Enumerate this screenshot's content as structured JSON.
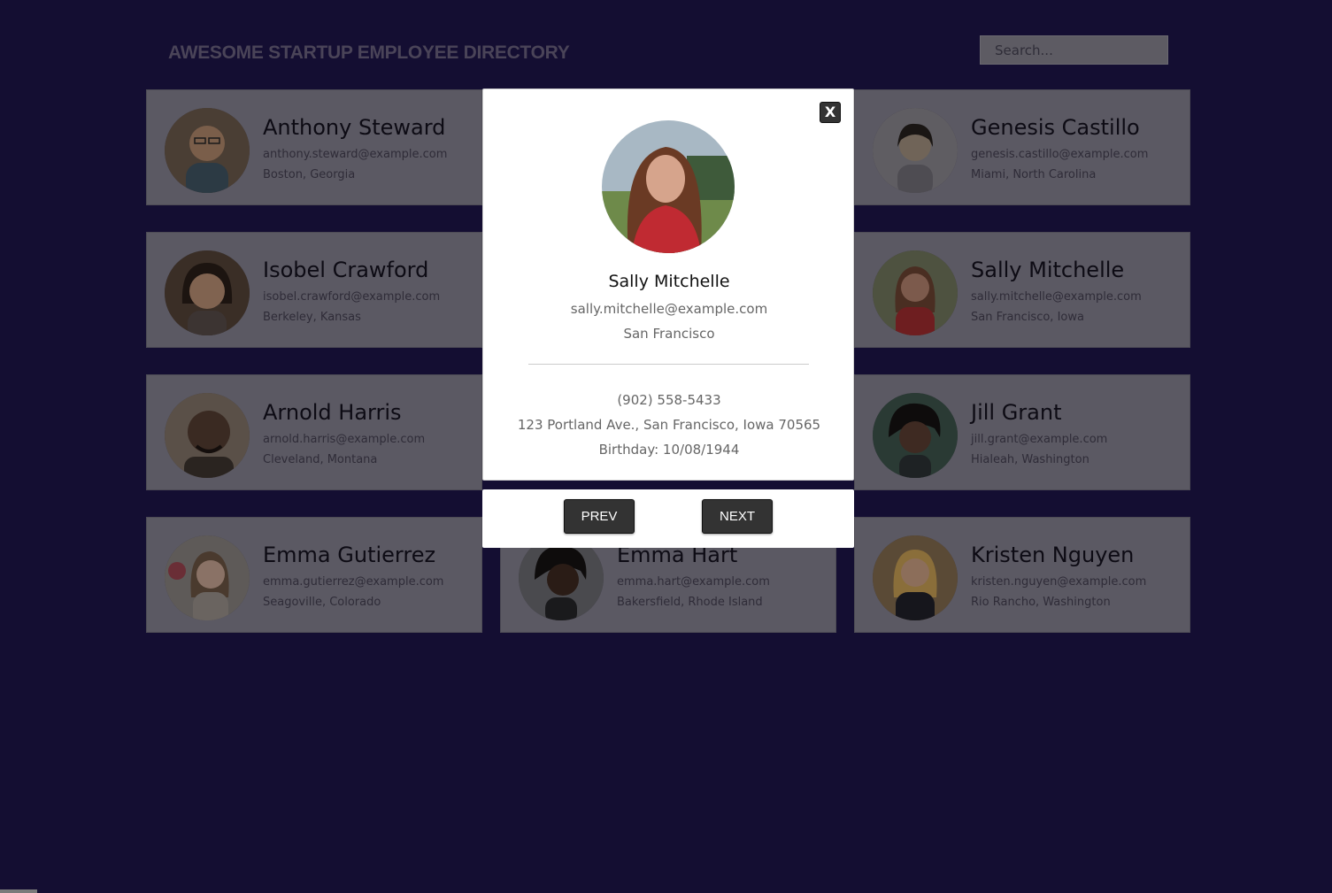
{
  "header": {
    "title": "AWESOME STARTUP EMPLOYEE DIRECTORY",
    "search_placeholder": "Search..."
  },
  "employees": [
    {
      "name": "Anthony Steward",
      "email": "anthony.steward@example.com",
      "location": "Boston, Georgia"
    },
    {
      "name": "Genesis Castillo",
      "email": "genesis.castillo@example.com",
      "location": "Miami, North Carolina"
    },
    {
      "name": "Isobel Crawford",
      "email": "isobel.crawford@example.com",
      "location": "Berkeley, Kansas"
    },
    {
      "name": "Sally Mitchelle",
      "email": "sally.mitchelle@example.com",
      "location": "San Francisco, Iowa"
    },
    {
      "name": "Arnold Harris",
      "email": "arnold.harris@example.com",
      "location": "Cleveland, Montana"
    },
    {
      "name": "Jill Grant",
      "email": "jill.grant@example.com",
      "location": "Hialeah, Washington"
    },
    {
      "name": "Emma Gutierrez",
      "email": "emma.gutierrez@example.com",
      "location": "Seagoville, Colorado"
    },
    {
      "name": "Emma Hart",
      "email": "emma.hart@example.com",
      "location": "Bakersfield, Rhode Island"
    },
    {
      "name": "Kristen Nguyen",
      "email": "kristen.nguyen@example.com",
      "location": "Rio Rancho, Washington"
    }
  ],
  "modal": {
    "close_label": "X",
    "name": "Sally Mitchelle",
    "email": "sally.mitchelle@example.com",
    "city": "San Francisco",
    "phone": "(902) 558-5433",
    "address": "123 Portland Ave., San Francisco, Iowa 70565",
    "birthday": "Birthday: 10/08/1944",
    "prev_label": "PREV",
    "next_label": "NEXT"
  }
}
